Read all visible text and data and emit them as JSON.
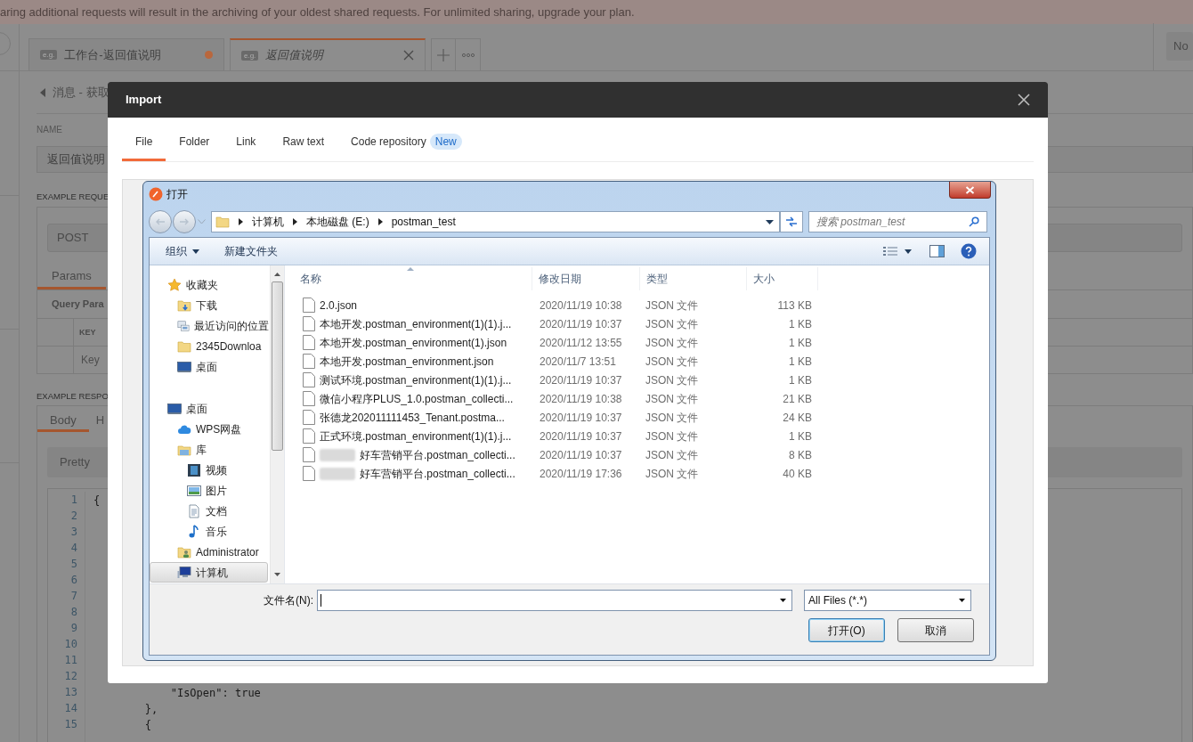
{
  "banner": {
    "text": "aring additional requests will result in the archiving of your oldest shared requests. For unlimited sharing, upgrade your plan."
  },
  "tabs": [
    {
      "badge": "e.g.",
      "label": "工作台-返回值说明",
      "selected": false,
      "unsaved": true,
      "preview": false
    },
    {
      "badge": "e.g.",
      "label": "返回值说明",
      "selected": true,
      "unsaved": false,
      "preview": true
    }
  ],
  "right_button": "No",
  "breadcrumb": "消息 - 获取",
  "name_field": {
    "label": "NAME",
    "value": "返回值说明"
  },
  "request": {
    "heading": "EXAMPLE REQUE",
    "method": "POST",
    "tabs": [
      {
        "label": "Params",
        "selected": true
      }
    ],
    "subheading": "Query Para",
    "columns": [
      "KEY"
    ],
    "placeholder": "Key"
  },
  "response": {
    "heading": "EXAMPLE RESPO",
    "tabs": [
      {
        "label": "Body",
        "selected": true
      },
      {
        "label": "H",
        "selected": false
      }
    ],
    "format": "Pretty",
    "code_lines": [
      {
        "number": "1",
        "text": "{"
      },
      {
        "number": "2"
      },
      {
        "number": "3"
      },
      {
        "number": "4"
      },
      {
        "number": "5"
      },
      {
        "number": "6"
      },
      {
        "number": "7"
      },
      {
        "number": "8"
      },
      {
        "number": "9"
      },
      {
        "number": "10"
      },
      {
        "number": "11"
      },
      {
        "number": "12"
      },
      {
        "number": "13",
        "text": "            \"IsOpen\": true"
      },
      {
        "number": "14",
        "text": "        },"
      },
      {
        "number": "15",
        "text": "        {"
      }
    ]
  },
  "import_dialog": {
    "title": "Import",
    "tabs": [
      {
        "label": "File",
        "selected": true
      },
      {
        "label": "Folder",
        "selected": false
      },
      {
        "label": "Link",
        "selected": false
      },
      {
        "label": "Raw text",
        "selected": false
      },
      {
        "label": "Code repository",
        "selected": false,
        "badge": "New"
      }
    ]
  },
  "file_dialog": {
    "title": "打开",
    "path": [
      "计算机",
      "本地磁盘 (E:)",
      "postman_test"
    ],
    "search": {
      "placeholder": "搜索 postman_test"
    },
    "toolbar": [
      {
        "label": "组织",
        "kind": "menu"
      },
      {
        "label": "新建文件夹",
        "kind": "button"
      }
    ],
    "nav": [
      {
        "label": "收藏夹",
        "kind": "favorites",
        "selected": false,
        "children": [
          {
            "label": "下载",
            "kind": "download",
            "selected": false
          },
          {
            "label": "最近访问的位置",
            "kind": "recent",
            "selected": false
          },
          {
            "label": "2345Downloa",
            "kind": "folder",
            "selected": false
          },
          {
            "label": "桌面",
            "kind": "desktop",
            "selected": false
          }
        ]
      },
      {
        "label": "桌面",
        "kind": "desktop",
        "selected": false,
        "children": [
          {
            "label": "WPS网盘",
            "kind": "cloud",
            "selected": false
          },
          {
            "label": "库",
            "kind": "library",
            "selected": false,
            "children": [
              {
                "label": "视频",
                "kind": "video",
                "selected": false
              },
              {
                "label": "图片",
                "kind": "picture",
                "selected": false
              },
              {
                "label": "文档",
                "kind": "document",
                "selected": false
              },
              {
                "label": "音乐",
                "kind": "music",
                "selected": false
              }
            ]
          },
          {
            "label": "Administrator",
            "kind": "user",
            "selected": false
          },
          {
            "label": "计算机",
            "kind": "computer",
            "selected": true
          }
        ]
      }
    ],
    "columns": [
      "名称",
      "修改日期",
      "类型",
      "大小"
    ],
    "files": [
      {
        "name": "2.0.json",
        "modified": "2020/11/19 10:38",
        "type": "JSON 文件",
        "size": "113 KB",
        "redacted": false
      },
      {
        "name": "本地开发.postman_environment(1)(1).j...",
        "modified": "2020/11/19 10:37",
        "type": "JSON 文件",
        "size": "1 KB",
        "redacted": false
      },
      {
        "name": "本地开发.postman_environment(1).json",
        "modified": "2020/11/12 13:55",
        "type": "JSON 文件",
        "size": "1 KB",
        "redacted": false
      },
      {
        "name": "本地开发.postman_environment.json",
        "modified": "2020/11/7 13:51",
        "type": "JSON 文件",
        "size": "1 KB",
        "redacted": false
      },
      {
        "name": "测试环境.postman_environment(1)(1).j...",
        "modified": "2020/11/19 10:37",
        "type": "JSON 文件",
        "size": "1 KB",
        "redacted": false
      },
      {
        "name": "微信小程序PLUS_1.0.postman_collecti...",
        "modified": "2020/11/19 10:38",
        "type": "JSON 文件",
        "size": "21 KB",
        "redacted": false
      },
      {
        "name": "张德龙202011111453_Tenant.postma...",
        "modified": "2020/11/19 10:37",
        "type": "JSON 文件",
        "size": "24 KB",
        "redacted": false
      },
      {
        "name": "正式环境.postman_environment(1)(1).j...",
        "modified": "2020/11/19 10:37",
        "type": "JSON 文件",
        "size": "1 KB",
        "redacted": false
      },
      {
        "name": "好车营销平台.postman_collecti...",
        "modified": "2020/11/19 10:37",
        "type": "JSON 文件",
        "size": "8 KB",
        "redacted": true
      },
      {
        "name": "好车营销平台.postman_collecti...",
        "modified": "2020/11/19 17:36",
        "type": "JSON 文件",
        "size": "40 KB",
        "redacted": true
      }
    ],
    "filename": {
      "label": "文件名(N):"
    },
    "filter": "All Files (*.*)",
    "buttons": [
      {
        "label": "打开(O)",
        "default": true
      },
      {
        "label": "取消",
        "default": false
      }
    ]
  }
}
